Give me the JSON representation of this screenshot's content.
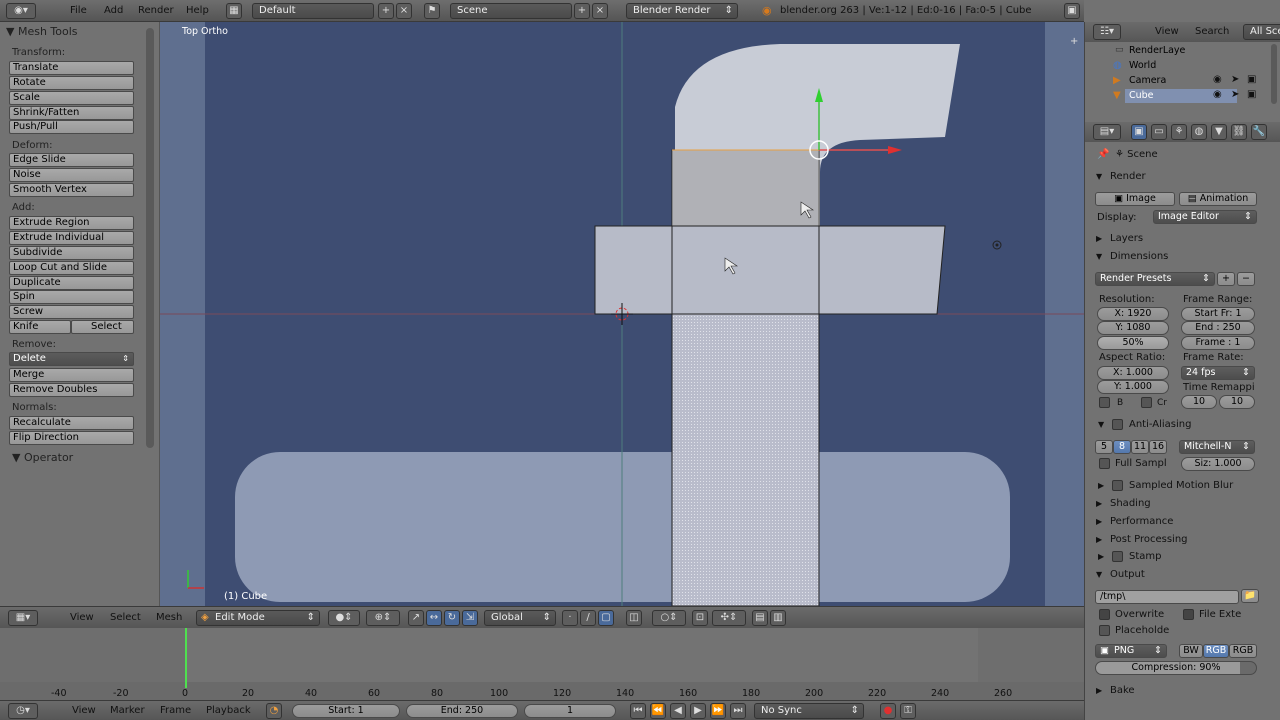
{
  "top_bar": {
    "menus": [
      "File",
      "Add",
      "Render",
      "Help"
    ],
    "screen_layout": "Default",
    "scene": "Scene",
    "render_engine": "Blender Render",
    "info": "blender.org 263 | Ve:1-12 | Ed:0-16 | Fa:0-5 | Cube"
  },
  "tool_shelf": {
    "title": "Mesh Tools",
    "transform_label": "Transform:",
    "transform": [
      "Translate",
      "Rotate",
      "Scale",
      "Shrink/Fatten",
      "Push/Pull"
    ],
    "deform_label": "Deform:",
    "deform": [
      "Edge Slide",
      "Noise",
      "Smooth Vertex"
    ],
    "add_label": "Add:",
    "add": [
      "Extrude Region",
      "Extrude Individual",
      "Subdivide",
      "Loop Cut and Slide",
      "Duplicate",
      "Spin",
      "Screw"
    ],
    "knife": "Knife",
    "select": "Select",
    "remove_label": "Remove:",
    "delete": "Delete",
    "remove": [
      "Merge",
      "Remove Doubles"
    ],
    "normals_label": "Normals:",
    "normals": [
      "Recalculate",
      "Flip Direction"
    ],
    "operator": "Operator"
  },
  "viewport": {
    "view_name": "Top Ortho",
    "object_label": "(1) Cube"
  },
  "view3d_header": {
    "menus": [
      "View",
      "Select",
      "Mesh"
    ],
    "mode": "Edit Mode",
    "orientation": "Global"
  },
  "timeline": {
    "ticks": [
      "-40",
      "-20",
      "0",
      "20",
      "40",
      "60",
      "80",
      "100",
      "120",
      "140",
      "160",
      "180",
      "200",
      "220",
      "240",
      "260"
    ],
    "menus": [
      "View",
      "Marker",
      "Frame",
      "Playback"
    ],
    "start": "Start: 1",
    "end": "End: 250",
    "current": "1",
    "sync": "No Sync"
  },
  "outliner": {
    "menus": [
      "View",
      "Search"
    ],
    "filter": "All Sce",
    "items": [
      "RenderLaye",
      "World",
      "Camera",
      "Cube"
    ]
  },
  "properties": {
    "context": "Scene",
    "render": {
      "header": "Render",
      "image_btn": "Image",
      "animation_btn": "Animation",
      "display_label": "Display:",
      "display_value": "Image Editor"
    },
    "layers": "Layers",
    "dimensions": {
      "header": "Dimensions",
      "presets": "Render Presets",
      "resolution_label": "Resolution:",
      "res_x": "X: 1920",
      "res_y": "Y: 1080",
      "res_pct": "50%",
      "frame_range_label": "Frame Range:",
      "start": "Start Fr: 1",
      "end": "End : 250",
      "frame": "Frame : 1",
      "aspect_label": "Aspect Ratio:",
      "asp_x": "X: 1.000",
      "asp_y": "Y: 1.000",
      "framerate_label": "Frame Rate:",
      "fps": "24 fps",
      "remap_label": "Time Remappi",
      "remap_old": "10",
      "remap_new": "10",
      "border_b": "B",
      "border_cr": "Cr"
    },
    "anti_aliasing": {
      "header": "Anti-Aliasing",
      "samples": [
        "5",
        "8",
        "11",
        "16"
      ],
      "filter": "Mitchell-N",
      "full_sample": "Full Sampl",
      "size": "Siz: 1.000"
    },
    "panels": [
      "Sampled Motion Blur",
      "Shading",
      "Performance",
      "Post Processing",
      "Stamp"
    ],
    "output": {
      "header": "Output",
      "path": "/tmp\\",
      "overwrite": "Overwrite",
      "file_ext": "File Exte",
      "placeholders": "Placeholde",
      "format": "PNG",
      "bw": "BW",
      "rgb": "RGB",
      "rgba": "RGB",
      "compression": "Compression: 90%"
    },
    "bake": "Bake"
  }
}
